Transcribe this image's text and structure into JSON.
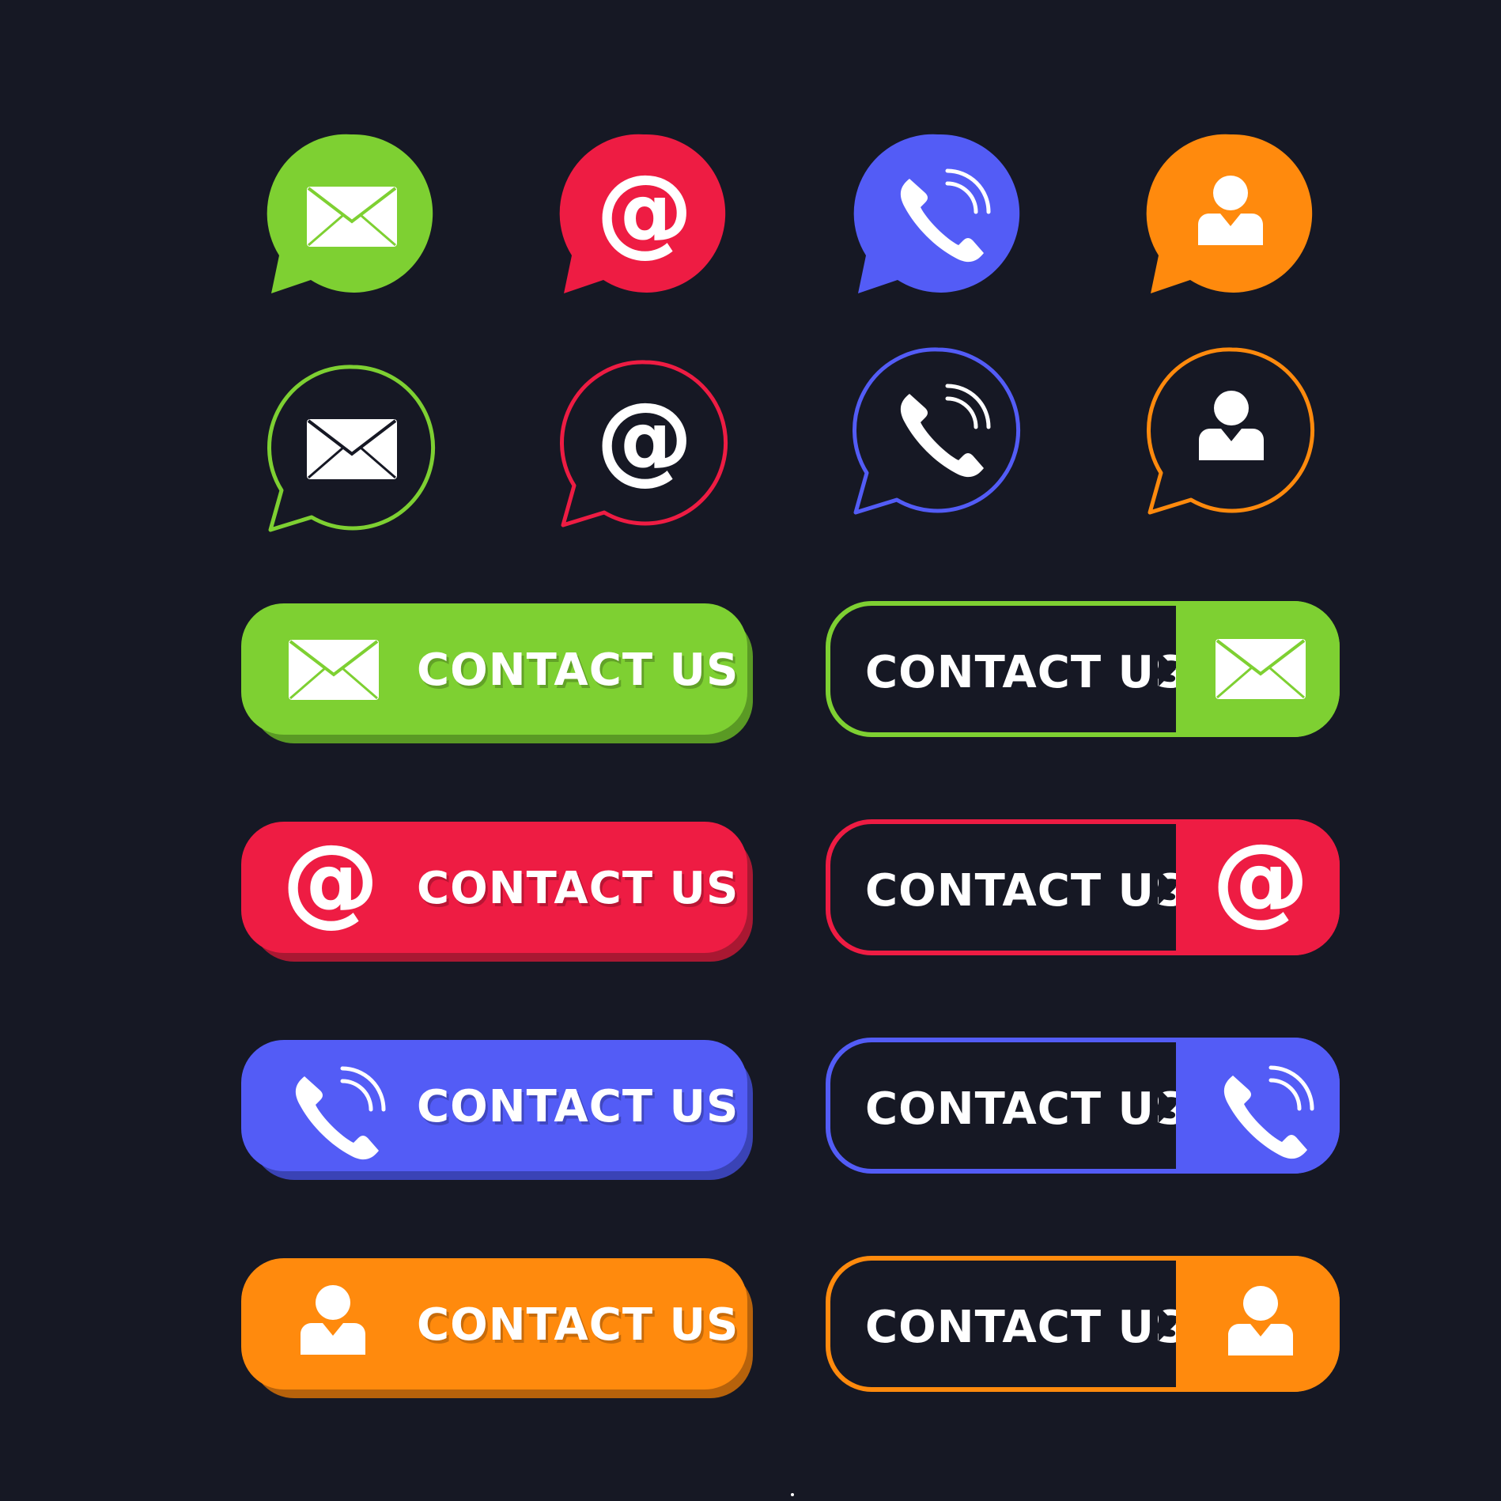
{
  "colors": {
    "background": "#161824",
    "green": "#7ed032",
    "green_dark": "#5a9a24",
    "red": "#ee1c43",
    "red_dark": "#a91832",
    "blue": "#535cf6",
    "blue_dark": "#3a43b6",
    "orange": "#ff8a0d",
    "orange_dark": "#b7620b",
    "white": "#ffffff"
  },
  "icon_names": [
    "mail-icon",
    "at-sign-icon",
    "phone-icon",
    "user-icon"
  ],
  "solid_buttons": [
    {
      "label": "CONTACT US",
      "icon": "mail-icon",
      "color": "green"
    },
    {
      "label": "CONTACT US",
      "icon": "at-sign-icon",
      "color": "red"
    },
    {
      "label": "CONTACT US",
      "icon": "phone-icon",
      "color": "blue"
    },
    {
      "label": "CONTACT US",
      "icon": "user-icon",
      "color": "orange"
    }
  ],
  "outline_buttons": [
    {
      "label": "CONTACT US",
      "icon": "mail-icon",
      "color": "green"
    },
    {
      "label": "CONTACT US",
      "icon": "at-sign-icon",
      "color": "red"
    },
    {
      "label": "CONTACT US",
      "icon": "phone-icon",
      "color": "blue"
    },
    {
      "label": "CONTACT US",
      "icon": "user-icon",
      "color": "orange"
    }
  ]
}
